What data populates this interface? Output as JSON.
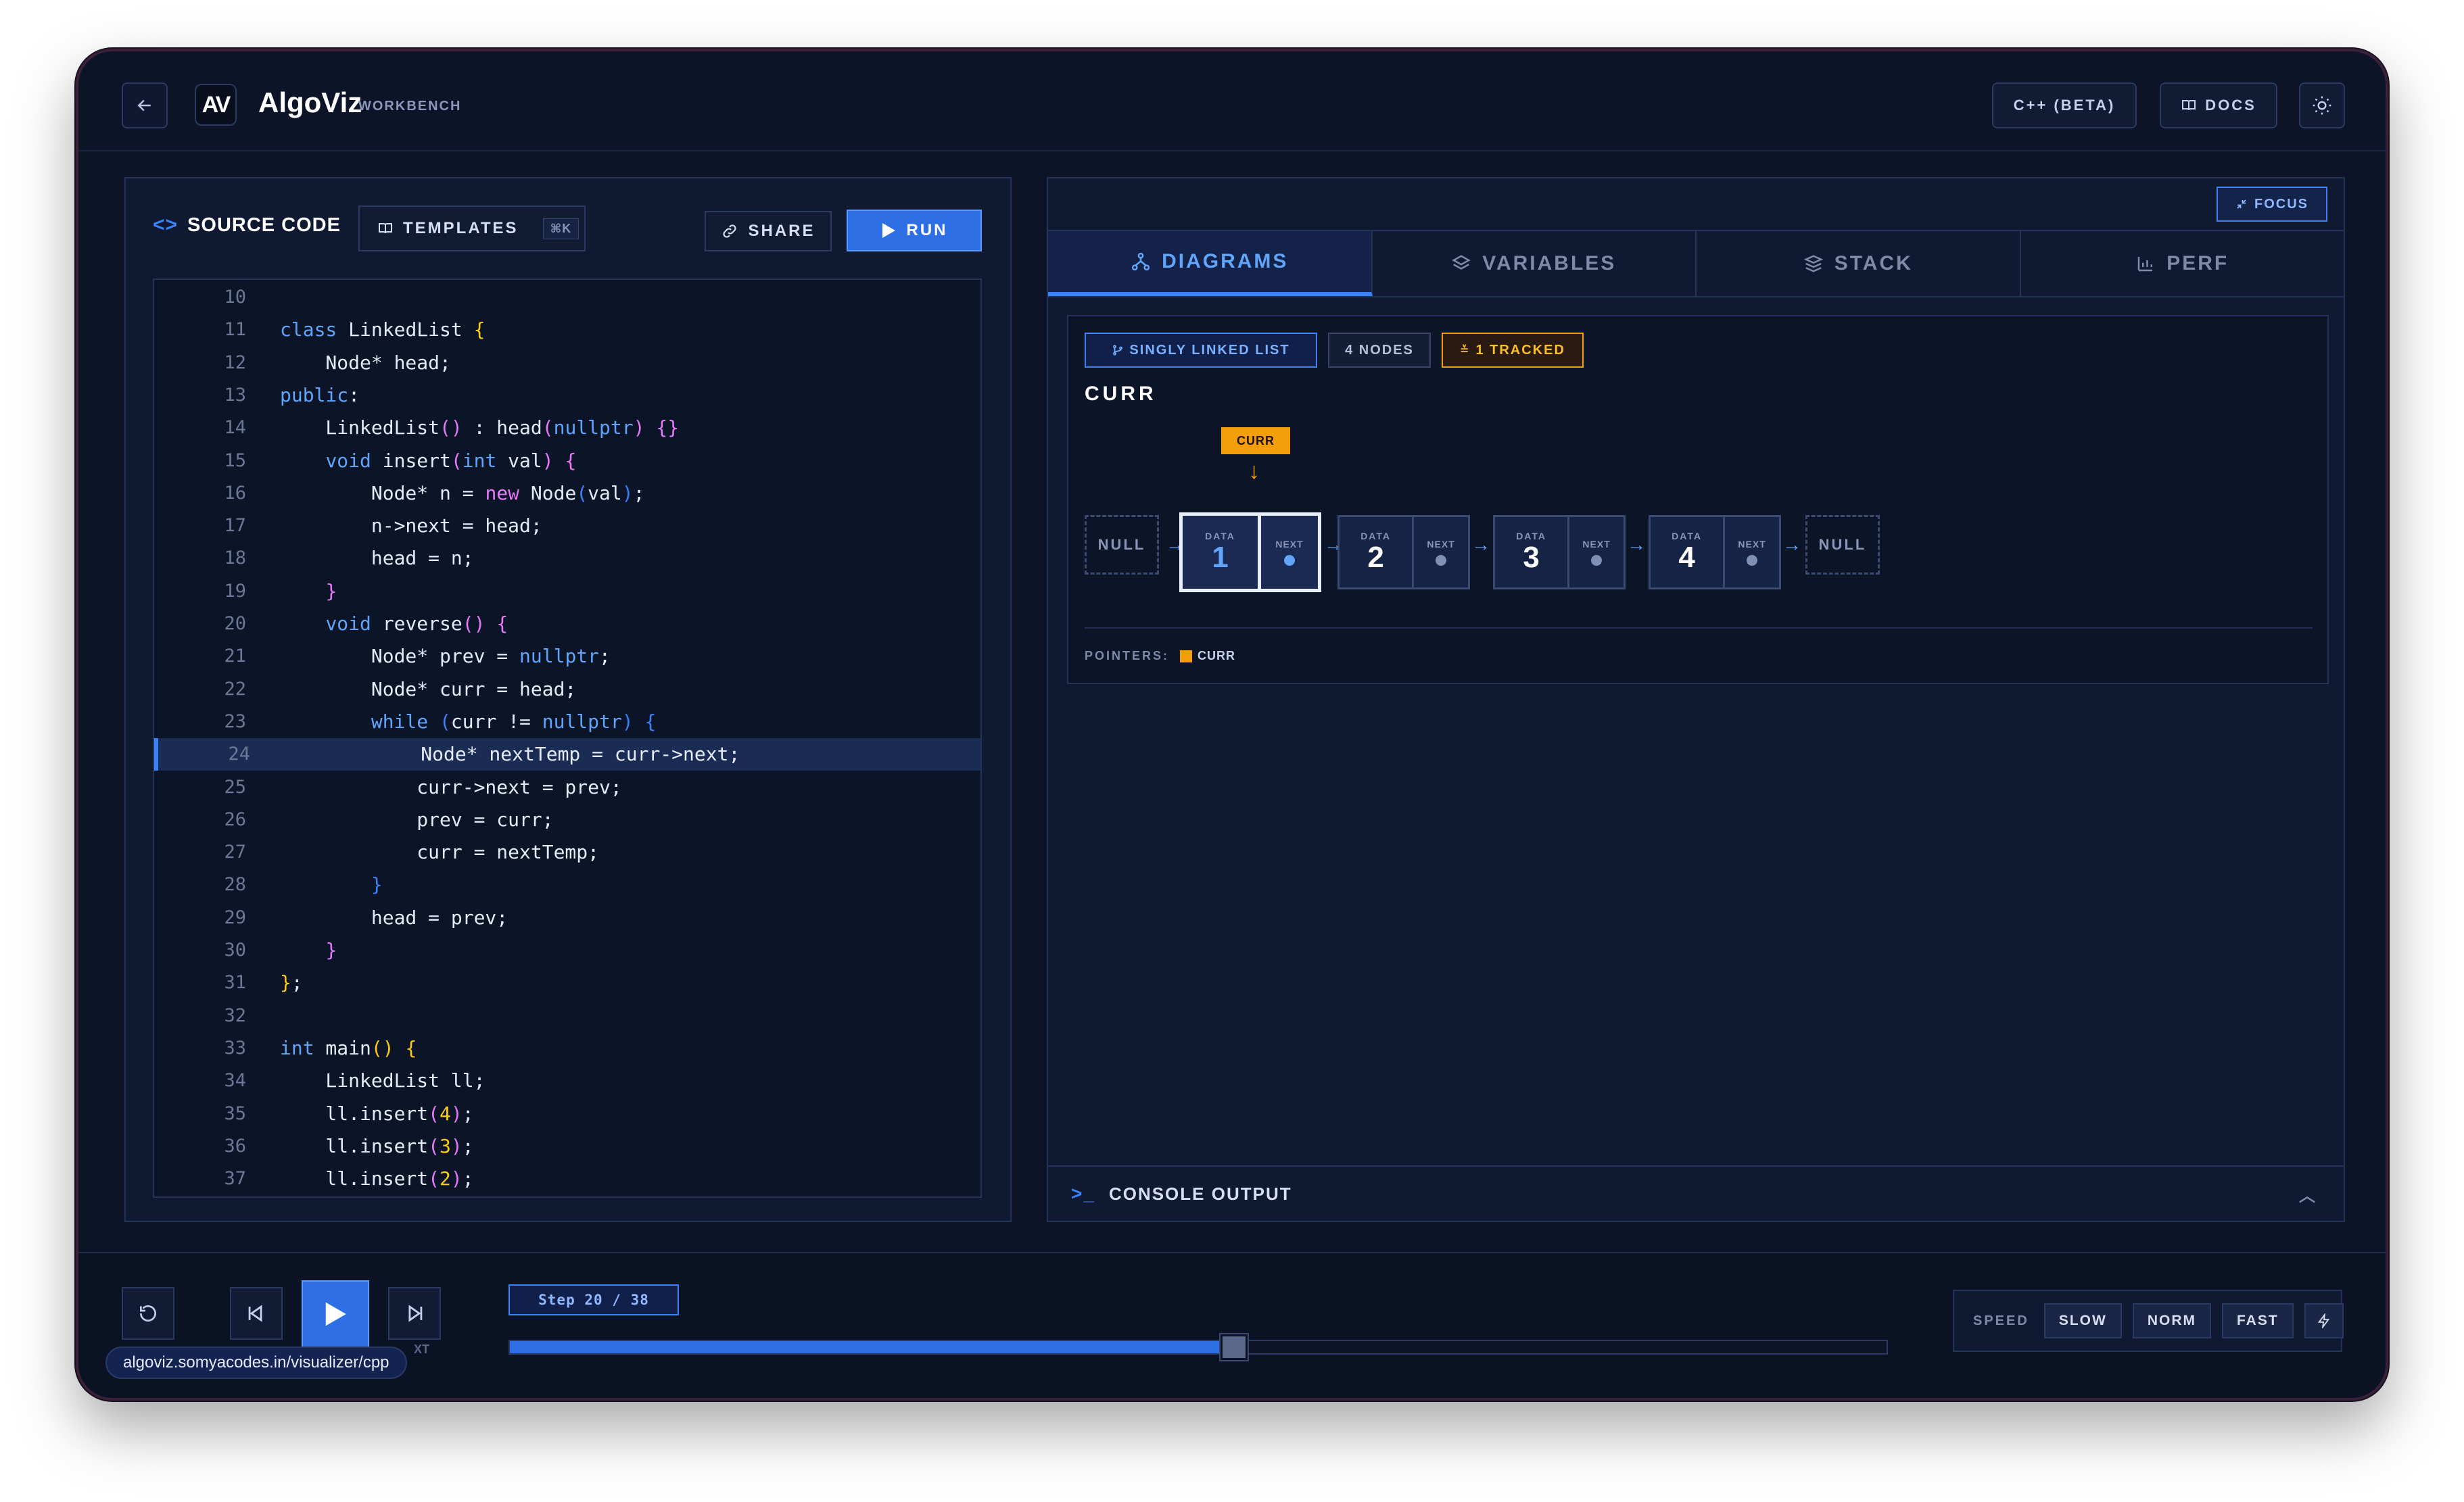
{
  "app": {
    "title": "AlgoViz",
    "subtitle": "WORKBENCH",
    "logo_text": "AV"
  },
  "header": {
    "lang_button": "C++ (BETA)",
    "docs_button": "DOCS"
  },
  "editor": {
    "title": "SOURCE CODE",
    "templates_label": "TEMPLATES",
    "templates_shortcut": "⌘K",
    "share_label": "SHARE",
    "run_label": "RUN",
    "active_line": 24,
    "lines": [
      {
        "n": "10",
        "html": ""
      },
      {
        "n": "11",
        "html": "<span class='kw'>class</span> LinkedList <span class='br'>{</span>"
      },
      {
        "n": "12",
        "html": "    Node* head;"
      },
      {
        "n": "13",
        "html": "<span class='kw'>public</span>:"
      },
      {
        "n": "14",
        "html": "    LinkedList<span class='br2'>()</span> : head<span class='br2'>(</span><span class='kw'>nullptr</span><span class='br2'>)</span> <span class='br2'>{}</span>"
      },
      {
        "n": "15",
        "html": "    <span class='kw'>void</span> insert<span class='br2'>(</span><span class='kw'>int</span> val<span class='br2'>)</span> <span class='br2'>{</span>"
      },
      {
        "n": "16",
        "html": "        Node* n = <span class='kw2'>new</span> Node<span class='br3'>(</span>val<span class='br3'>)</span>;"
      },
      {
        "n": "17",
        "html": "        n-&gt;next = head;"
      },
      {
        "n": "18",
        "html": "        head = n;"
      },
      {
        "n": "19",
        "html": "    <span class='br2'>}</span>"
      },
      {
        "n": "20",
        "html": "    <span class='kw'>void</span> reverse<span class='br2'>()</span> <span class='br2'>{</span>"
      },
      {
        "n": "21",
        "html": "        Node* prev = <span class='kw'>nullptr</span>;"
      },
      {
        "n": "22",
        "html": "        Node* curr = head;"
      },
      {
        "n": "23",
        "html": "        <span class='kw'>while</span> <span class='br3'>(</span>curr != <span class='kw'>nullptr</span><span class='br3'>)</span> <span class='br3'>{</span>"
      },
      {
        "n": "24",
        "html": "            Node* nextTemp = curr-&gt;next;"
      },
      {
        "n": "25",
        "html": "            curr-&gt;next = prev;"
      },
      {
        "n": "26",
        "html": "            prev = curr;"
      },
      {
        "n": "27",
        "html": "            curr = nextTemp;"
      },
      {
        "n": "28",
        "html": "        <span class='br3'>}</span>"
      },
      {
        "n": "29",
        "html": "        head = prev;"
      },
      {
        "n": "30",
        "html": "    <span class='br2'>}</span>"
      },
      {
        "n": "31",
        "html": "<span class='br'>}</span>;"
      },
      {
        "n": "32",
        "html": ""
      },
      {
        "n": "33",
        "html": "<span class='kw'>int</span> main<span class='br'>()</span> <span class='br'>{</span>"
      },
      {
        "n": "34",
        "html": "    LinkedList ll;"
      },
      {
        "n": "35",
        "html": "    ll.insert<span class='br2'>(</span><span class='num'>4</span><span class='br2'>)</span>;"
      },
      {
        "n": "36",
        "html": "    ll.insert<span class='br2'>(</span><span class='num'>3</span><span class='br2'>)</span>;"
      },
      {
        "n": "37",
        "html": "    ll.insert<span class='br2'>(</span><span class='num'>2</span><span class='br2'>)</span>;"
      }
    ]
  },
  "viz": {
    "focus_label": "FOCUS",
    "tabs": [
      {
        "label": "DIAGRAMS",
        "active": true
      },
      {
        "label": "VARIABLES",
        "active": false
      },
      {
        "label": "STACK",
        "active": false
      },
      {
        "label": "PERF",
        "active": false
      }
    ],
    "tags": {
      "type": "SINGLY LINKED LIST",
      "nodes": "4 NODES",
      "tracked": "1 TRACKED"
    },
    "var_title": "CURR",
    "pointer_badge": "CURR",
    "null_label": "NULL",
    "data_label": "DATA",
    "next_label": "NEXT",
    "nodes": [
      "1",
      "2",
      "3",
      "4"
    ],
    "highlighted_node": 0,
    "legend_label": "POINTERS:",
    "legend_pointer": "CURR"
  },
  "console": {
    "label": "CONSOLE OUTPUT"
  },
  "player": {
    "step_text": "Step 20 / 38",
    "progress": 0.526,
    "speed_label": "SPEED",
    "speed_options": [
      "SLOW",
      "NORM",
      "FAST"
    ],
    "url": "algoviz.somyacodes.in/visualizer/cpp",
    "url_tail": "XT"
  },
  "colors": {
    "accent": "#3b82f6",
    "pointer": "#f59e0b",
    "background": "#0d1428"
  }
}
